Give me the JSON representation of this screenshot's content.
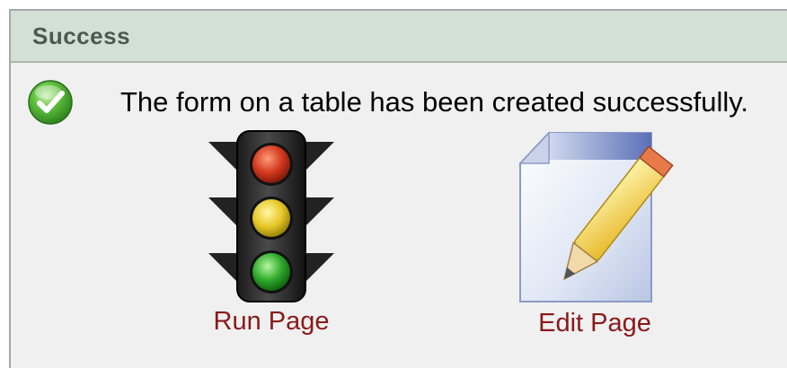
{
  "region": {
    "title": "Success"
  },
  "status": {
    "icon": "check-circle-icon",
    "message": "The form on a table has been created successfully."
  },
  "actions": {
    "run_page": {
      "label": "Run Page",
      "icon": "traffic-light-icon"
    },
    "edit_page": {
      "label": "Edit Page",
      "icon": "page-pencil-icon"
    }
  },
  "colors": {
    "header_bg": "#d3e1d5",
    "body_bg": "#f0f0f0",
    "link": "#8b1a1a",
    "title": "#4a5a52"
  }
}
